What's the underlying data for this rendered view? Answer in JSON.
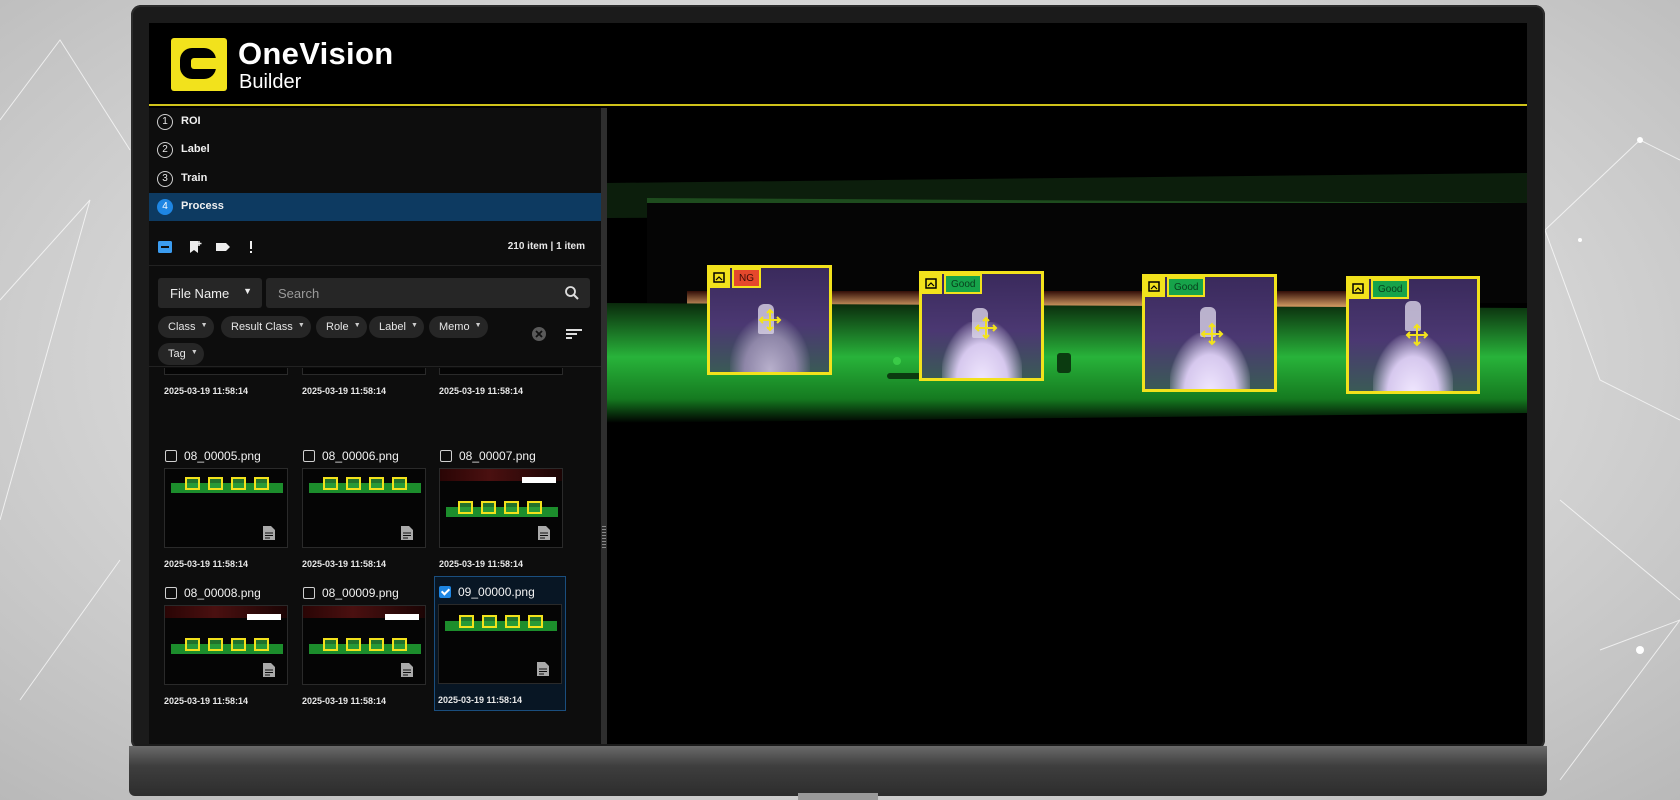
{
  "app": {
    "logo_letter": "C",
    "name": "OneVision",
    "subtitle": "Builder",
    "accent_color": "#f2e21c"
  },
  "steps": [
    {
      "number": "1",
      "label": "ROI",
      "active": false
    },
    {
      "number": "2",
      "label": "Label",
      "active": false
    },
    {
      "number": "3",
      "label": "Train",
      "active": false
    },
    {
      "number": "4",
      "label": "Process",
      "active": true
    }
  ],
  "toolbar": {
    "icons": [
      "select-all-icon",
      "bookmark-add-icon",
      "label-tag-icon",
      "more-icon"
    ],
    "count": "210 item | 1 item"
  },
  "filter": {
    "field_label": "File Name",
    "search_placeholder": "Search",
    "chips": [
      "Class",
      "Result Class",
      "Role",
      "Label",
      "Memo",
      "Tag"
    ]
  },
  "gallery": {
    "top_row_dates": [
      "2025-03-19 11:58:14",
      "2025-03-19 11:58:14",
      "2025-03-19 11:58:14"
    ],
    "items": [
      {
        "name": "08_00005.png",
        "date": "2025-03-19 11:58:14",
        "checked": false
      },
      {
        "name": "08_00006.png",
        "date": "2025-03-19 11:58:14",
        "checked": false
      },
      {
        "name": "08_00007.png",
        "date": "2025-03-19 11:58:14",
        "checked": false
      },
      {
        "name": "08_00008.png",
        "date": "2025-03-19 11:58:14",
        "checked": false
      },
      {
        "name": "08_00009.png",
        "date": "2025-03-19 11:58:14",
        "checked": false
      },
      {
        "name": "09_00000.png",
        "date": "2025-03-19 11:58:14",
        "checked": true
      }
    ]
  },
  "viewer": {
    "detections": [
      {
        "result": "NG",
        "color": "#e5482c"
      },
      {
        "result": "Good",
        "color": "#16a34a"
      },
      {
        "result": "Good",
        "color": "#16a34a"
      },
      {
        "result": "Good",
        "color": "#16a34a"
      }
    ]
  }
}
